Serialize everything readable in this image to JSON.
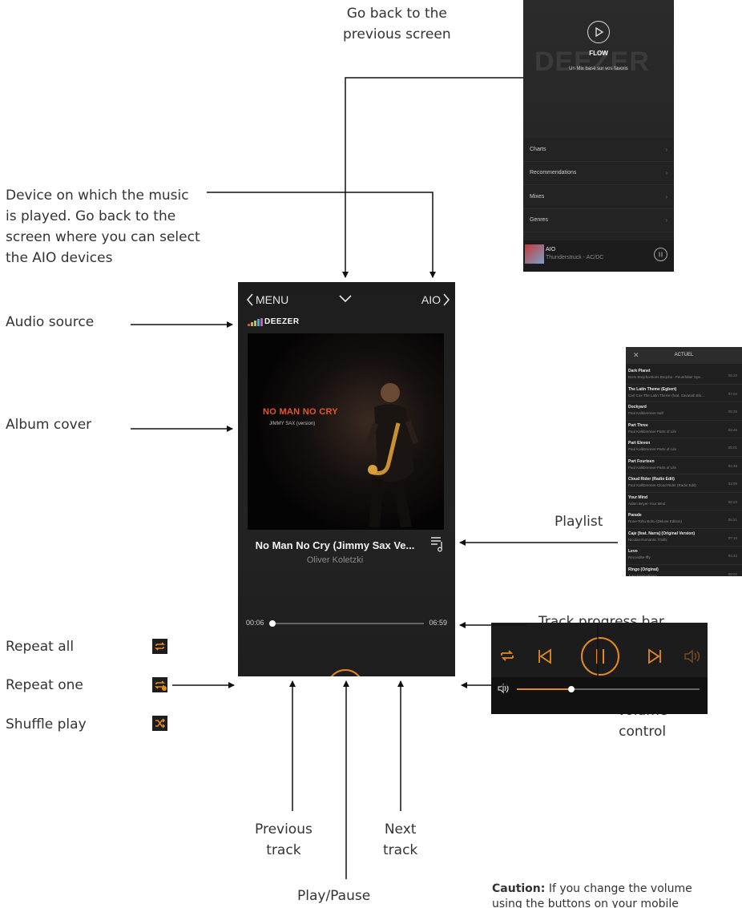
{
  "annotations": {
    "go_back_line1": "Go back to the",
    "go_back_line2": "previous screen",
    "device_line1": "Device on which the music",
    "device_line2": "is played. Go back to the",
    "device_line3": "screen where you can select",
    "device_line4": "the AIO devices",
    "audio_source": "Audio source",
    "album_cover": "Album cover",
    "playlist": "Playlist",
    "track_progress_bar": "Track progress bar",
    "repeat_all": "Repeat all",
    "repeat_one": "Repeat one",
    "shuffle_play": "Shuffle play",
    "volume_line1": "Volume",
    "volume_line2": "control",
    "previous_line1": "Previous",
    "previous_line2": "track",
    "next_line1": "Next",
    "next_line2": "track",
    "play_pause": "Play/Pause",
    "caution_bold": "Caution:",
    "caution_text": "If you change the volume",
    "caution_text2": "using the buttons on your mobile"
  },
  "player": {
    "menu_label": "MENU",
    "device_label": "AIO",
    "source_logo": "DEEZER",
    "cover_title": "NO MAN NO CRY",
    "cover_subtitle": "JIMMY SAX (version)",
    "track_title": "No Man No Cry (Jimmy Sax Ve...",
    "track_artist": "Oliver Koletzki",
    "elapsed": "00:06",
    "duration": "06:59",
    "progress_fraction": 0.015,
    "accent_color": "#e48a1f"
  },
  "flow_screen": {
    "watermark": "DEEZER",
    "flow_label": "FLOW",
    "flow_subtitle": "Un Mix basé sur vos favoris",
    "menu_items": [
      "Charts",
      "Recommendations",
      "Mixes",
      "Genres"
    ],
    "now_playing_title": "AIO",
    "now_playing_artist": "Thunderstruck - AC/DC"
  },
  "playlist_screen": {
    "header": "ACTUEL",
    "tracks": [
      {
        "name": "Dark Planet",
        "sub": "Boris Brejcha-Boris Brejcha - Feuerfalter Spe...",
        "dur": "06:23"
      },
      {
        "name": "The Latin Theme (Egbert)",
        "sub": "Carl Cox-The Latin Theme (feat. Savanah Blo...",
        "dur": "07:04"
      },
      {
        "name": "Dockyard",
        "sub": "Paul Kalkbrenner-Self",
        "dur": "05:26"
      },
      {
        "name": "Part Three",
        "sub": "Paul Kalkbrenner-Parts of Life",
        "dur": "03:46"
      },
      {
        "name": "Part Eleven",
        "sub": "Paul Kalkbrenner-Parts of Life",
        "dur": "05:01"
      },
      {
        "name": "Part Fourteen",
        "sub": "Paul Kalkbrenner-Parts of Life",
        "dur": "04:48"
      },
      {
        "name": "Cloud Rider (Radio Edit)",
        "sub": "Paul Kalkbrenner-Cloud Rider (Radio Edit)",
        "dur": "03:09"
      },
      {
        "name": "Your Mind",
        "sub": "Adam Beyer-Your Mind",
        "dur": "06:23"
      },
      {
        "name": "Parade",
        "sub": "Rone-Tohu Bohu (Deluxe Edition)",
        "dur": "06:21"
      },
      {
        "name": "Caje [feat. Narra] (Original Version)",
        "sub": "Nicolas-Romantic Thrills",
        "dur": "07:16"
      },
      {
        "name": "Levo",
        "sub": "Recondite-Iffy",
        "dur": "04:42"
      },
      {
        "name": "Ringo (Original)",
        "sub": "Juno Keem-Ringo",
        "dur": "08:02"
      }
    ]
  },
  "volume_panel": {
    "volume_fraction": 0.3
  },
  "icons": {
    "legend_repeat_all": "repeat-all-icon",
    "legend_repeat_one": "repeat-one-icon",
    "legend_shuffle": "shuffle-icon"
  }
}
